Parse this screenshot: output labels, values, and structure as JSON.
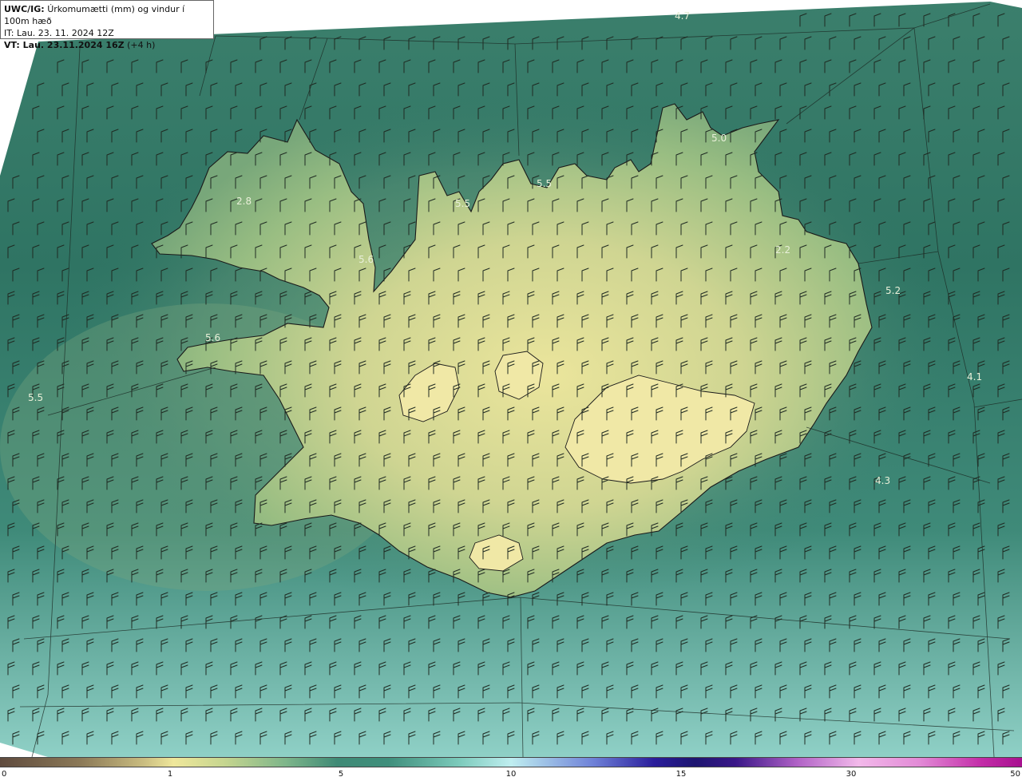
{
  "header": {
    "model": "UWC/IG:",
    "title": "Úrkomumætti (mm) og vindur í 100m hæð",
    "init_time": "IT: Lau. 23. 11. 2024 12Z",
    "valid_prefix": "VT: ",
    "valid_time": "Lau. 23.11.2024 16Z",
    "lead": "(+4 h)"
  },
  "map_labels": [
    "4.7",
    "5.0",
    "5.5",
    "5.5",
    "5.6",
    "2.8",
    "2.2",
    "5.2",
    "5.6",
    "5.5",
    "4.1",
    "4.3"
  ],
  "colors": {
    "sea_dark": "#2f7566",
    "sea_mid": "#3d8a78",
    "sea_light": "#9fd8cf",
    "land_low": "#6f9c74",
    "land_high": "#e4e39a",
    "coastline": "#1a1a1a",
    "barb": "#1f2a22"
  },
  "colorbar": {
    "ticks": [
      "0",
      "1",
      "5",
      "10",
      "15",
      "30",
      "50"
    ],
    "positions_fraction": [
      0.0,
      0.167,
      0.333,
      0.5,
      0.667,
      0.833,
      1.0
    ]
  }
}
